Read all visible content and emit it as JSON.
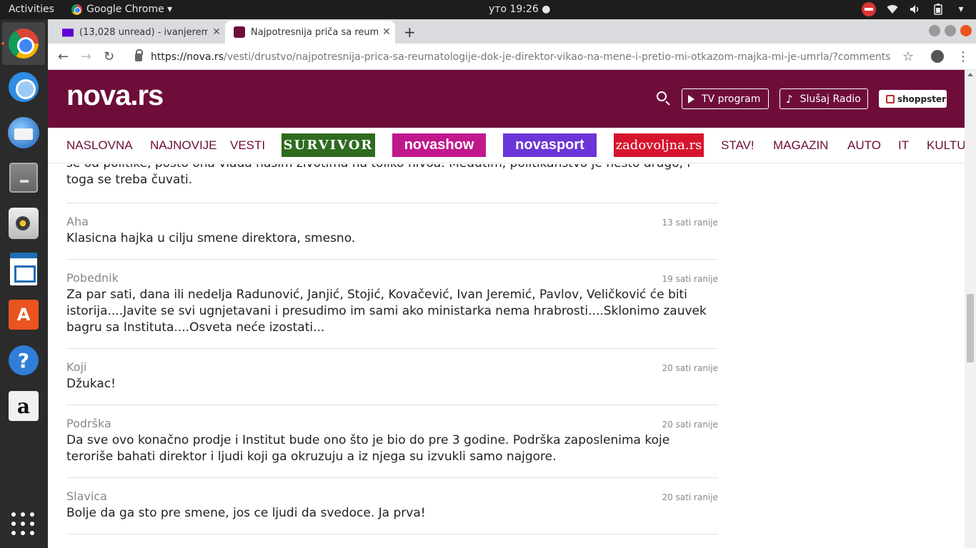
{
  "system_bar": {
    "activities": "Activities",
    "app_name": "Google Chrome ▾",
    "clock": "уто 19:26 ●"
  },
  "dock": {
    "apps": [
      "chrome-icon",
      "chromium-icon",
      "thunderbird-icon",
      "files-icon",
      "rhythmbox-icon",
      "libreoffice-writer-icon",
      "ubuntu-software-icon",
      "help-icon",
      "amazon-icon",
      "show-applications-icon"
    ]
  },
  "browser": {
    "tabs": [
      {
        "title": "(13,028 unread) - ivanjerem",
        "close": "✕"
      },
      {
        "title": "Najpotresnija priča sa reum",
        "close": "✕"
      }
    ],
    "new_tab": "+",
    "url_host": "https://nova.rs",
    "url_path": "/vesti/drustvo/najpotresnija-prica-sa-reumatologije-dok-je-direktor-vikao-na-mene-i-pretio-mi-otkazom-majka-mi-je-umrla/?comments"
  },
  "site": {
    "logo": "nova.rs",
    "tv_program": "TV program",
    "radio": "Slušaj Radio",
    "shoppster": "shoppster",
    "nav": {
      "naslovna": "NASLOVNA",
      "najnovije": "NAJNOVIJE",
      "vesti": "VESTI",
      "survivor": "SURVIVOR",
      "novashow": "novashow",
      "novasport": "novasport",
      "zadovoljna": "zadovoljna.rs",
      "stav": "STAV!",
      "magazin": "MAGAZIN",
      "auto": "AUTO",
      "it": "IT",
      "kultura": "KULTU"
    }
  },
  "comments": {
    "partial_top": "se od politike, pošto ona vlada našim životima na toliko nivoa. Međutim, politikanstvo je nešto drugo, i toga se treba čuvati.",
    "items": [
      {
        "author": "Aha",
        "time": "13 sati ranije",
        "text": "Klasicna hajka u cilju smene direktora, smesno."
      },
      {
        "author": "Pobednik",
        "time": "19 sati ranije",
        "text": "Za par sati, dana ili nedelja Radunović, Janjić, Stojić, Kovačević, Ivan Jeremić, Pavlov, Veličković će biti istorija....Javite se svi ugnjetavani i presudimo im sami ako ministarka nema hrabrosti....Sklonimo zauvek bagru sa Instituta....Osveta neće izostati..."
      },
      {
        "author": "Koji",
        "time": "20 sati ranije",
        "text": "Džukac!"
      },
      {
        "author": "Podrška",
        "time": "20 sati ranije",
        "text": "Da sve ovo konačno prodje i Institut bude ono što je bio do pre 3 godine. Podrška zaposlenima koje teroriše bahati direktor i ljudi koji ga okruzuju a iz njega su izvukli samo najgore."
      },
      {
        "author": "Slavica",
        "time": "20 sati ranije",
        "text": "Bolje da ga sto pre smene, jos ce ljudi da svedoce. Ja prva!"
      }
    ]
  },
  "colors": {
    "brand": "#6e0d3a",
    "survivor": "#2e6b1f",
    "novashow": "#c1188c",
    "novasport": "#6b35d8",
    "zadovoljna": "#d6142e"
  }
}
